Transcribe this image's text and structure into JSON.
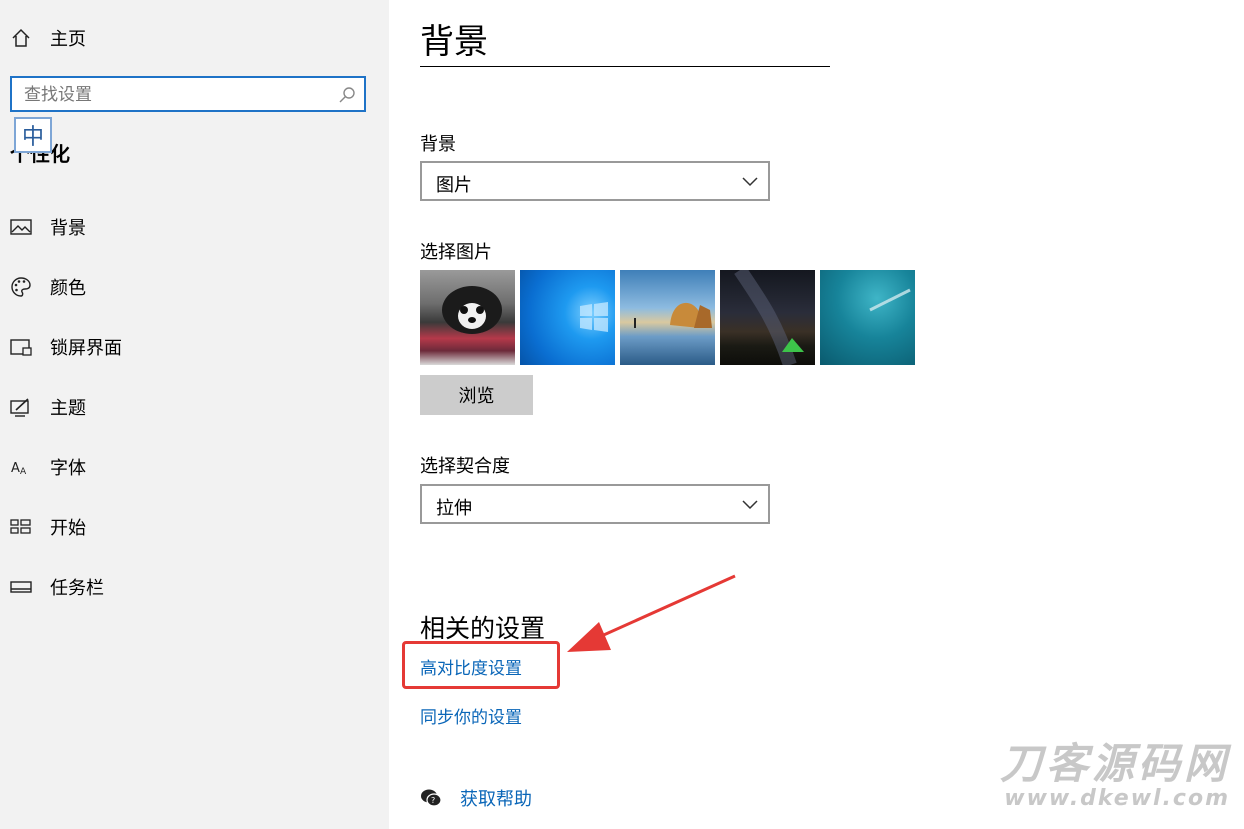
{
  "sidebar": {
    "home_label": "主页",
    "search_placeholder": "查找设置",
    "ime_label": "中",
    "section_title": "个性化",
    "items": [
      {
        "label": "背景",
        "icon": "picture-icon"
      },
      {
        "label": "颜色",
        "icon": "palette-icon"
      },
      {
        "label": "锁屏界面",
        "icon": "lock-screen-icon"
      },
      {
        "label": "主题",
        "icon": "theme-icon"
      },
      {
        "label": "字体",
        "icon": "font-icon"
      },
      {
        "label": "开始",
        "icon": "start-icon"
      },
      {
        "label": "任务栏",
        "icon": "taskbar-icon"
      }
    ]
  },
  "main": {
    "title": "背景",
    "background_label": "背景",
    "background_value": "图片",
    "choose_picture_label": "选择图片",
    "browse_label": "浏览",
    "fit_label": "选择契合度",
    "fit_value": "拉伸",
    "related_title": "相关的设置",
    "link_contrast": "高对比度设置",
    "link_sync": "同步你的设置",
    "help_label": "获取帮助"
  },
  "watermark": {
    "line1": "刀客源码网",
    "line2": "www.dkewl.com"
  },
  "colors": {
    "accent": "#1f73c7",
    "link": "#0a66b8",
    "highlight": "#e53935",
    "sidebar_bg": "#f2f2f2"
  }
}
